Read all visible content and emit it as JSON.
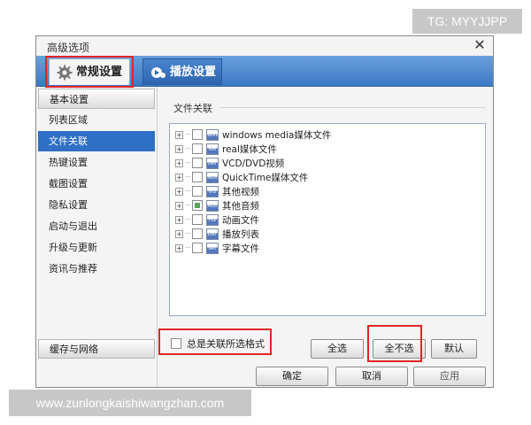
{
  "watermark_top": "TG: MYYJJPP",
  "watermark_bottom": "www.zunlongkaishiwangzhan.com",
  "dialog": {
    "title": "高级选项",
    "close_glyph": "✕"
  },
  "tabs": [
    {
      "label": "常规设置",
      "icon": "gear-icon",
      "active": true
    },
    {
      "label": "播放设置",
      "icon": "play-settings-icon",
      "active": false
    }
  ],
  "sidebar": {
    "items": [
      {
        "label": "基本设置",
        "state": "header"
      },
      {
        "label": "列表区域",
        "state": "normal"
      },
      {
        "label": "文件关联",
        "state": "selected"
      },
      {
        "label": "热键设置",
        "state": "normal"
      },
      {
        "label": "截图设置",
        "state": "normal"
      },
      {
        "label": "隐私设置",
        "state": "normal"
      },
      {
        "label": "启动与退出",
        "state": "normal"
      },
      {
        "label": "升级与更新",
        "state": "normal"
      },
      {
        "label": "资讯与推荐",
        "state": "normal"
      }
    ],
    "cache_button": "缓存与网络"
  },
  "file_assoc": {
    "group_title": "文件关联",
    "items": [
      {
        "label": "windows media媒体文件",
        "icon_text": "WMV",
        "checked": "none"
      },
      {
        "label": "real媒体文件",
        "icon_text": "RM",
        "checked": "none"
      },
      {
        "label": "VCD/DVD视频",
        "icon_text": "DAT",
        "checked": "none"
      },
      {
        "label": "QuickTime媒体文件",
        "icon_text": "MOV",
        "checked": "none"
      },
      {
        "label": "其他视频",
        "icon_text": "VID",
        "checked": "none"
      },
      {
        "label": "其他音频",
        "icon_text": "AUD",
        "checked": "partial"
      },
      {
        "label": "动画文件",
        "icon_text": "FLV",
        "checked": "none"
      },
      {
        "label": "播放列表",
        "icon_text": "LIST",
        "checked": "none"
      },
      {
        "label": "字幕文件",
        "icon_text": "SRT",
        "checked": "none"
      }
    ],
    "always_associate_label": "总是关联所选格式",
    "always_associate_checked": false
  },
  "buttons": {
    "select_all": "全选",
    "select_none": "全不选",
    "default": "默认",
    "ok": "确定",
    "cancel": "取消",
    "apply": "应用"
  },
  "colors": {
    "accent": "#2f6fc4",
    "highlight_box": "#e12626",
    "tab_bar": "#3d78c4"
  }
}
